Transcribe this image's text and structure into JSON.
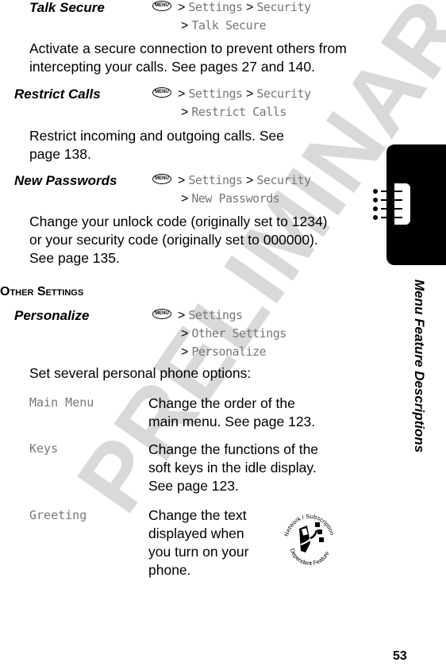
{
  "watermark": "PRELIMINARY",
  "menu_key_label": "MENU",
  "entries": [
    {
      "title": "Talk Secure",
      "path": [
        "Settings",
        "Security",
        "Talk Secure"
      ],
      "description": [
        "Activate a secure connection to prevent others from",
        "intercepting your calls. See pages 27 and 140."
      ]
    },
    {
      "title": "Restrict Calls",
      "path": [
        "Settings",
        "Security",
        "Restrict Calls"
      ],
      "description": [
        "Restrict incoming and outgoing calls. See",
        "page 138."
      ]
    },
    {
      "title": "New Passwords",
      "path": [
        "Settings",
        "Security",
        "New Passwords"
      ],
      "description": [
        "Change your unlock code (originally set to 1234)",
        "or your security code (originally set to 000000).",
        "See page 135."
      ]
    }
  ],
  "section_title": "Other Settings",
  "personalize": {
    "title": "Personalize",
    "path": [
      "Settings",
      "Other Settings",
      "Personalize"
    ],
    "description": "Set several personal phone options:",
    "options": [
      {
        "name": "Main Menu",
        "description": [
          "Change the order of the",
          "main menu. See page 123."
        ]
      },
      {
        "name": "Keys",
        "description": [
          "Change the functions of the",
          "soft keys in the idle display.",
          "See page 123."
        ]
      },
      {
        "name": "Greeting",
        "description": [
          "Change the text",
          "displayed when",
          "you turn on your",
          "phone."
        ]
      }
    ]
  },
  "badge": {
    "top_text": "Network / Subscription",
    "bottom_text": "Dependent Feature"
  },
  "side_tab": {
    "title": "Menu Feature Descriptions",
    "icon": "list-icon"
  },
  "page_number": "53"
}
